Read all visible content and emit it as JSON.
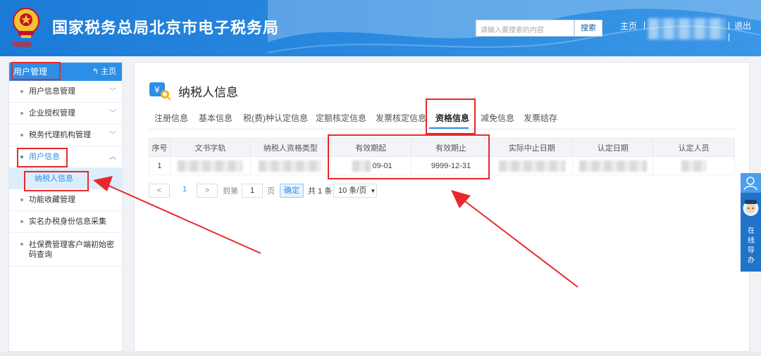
{
  "header": {
    "title": "国家税务总局北京市电子税务局",
    "emblem_caption": "中国税务",
    "search_placeholder": "请输入要搜索的内容",
    "search_button": "搜索",
    "home_link": "主页",
    "separator": "|",
    "logout": "退出"
  },
  "sidebar": {
    "header_title": "用户管理",
    "header_home": "主页",
    "items": [
      {
        "label": "用户信息管理"
      },
      {
        "label": "企业授权管理"
      },
      {
        "label": "税务代理机构管理"
      },
      {
        "label": "用户信息"
      },
      {
        "label": "纳税人信息"
      },
      {
        "label": "功能收藏管理"
      },
      {
        "label": "实名办税身份信息采集"
      },
      {
        "label": "社保费管理客户端初始密码查询"
      }
    ]
  },
  "main": {
    "title": "纳税人信息",
    "tabs": [
      "注册信息",
      "基本信息",
      "税(费)种认定信息",
      "定额核定信息",
      "发票核定信息",
      "资格信息",
      "减免信息",
      "发票结存"
    ],
    "active_tab": "资格信息",
    "table": {
      "headers": [
        "序号",
        "文书字轨",
        "纳税人资格类型",
        "有效期起",
        "有效期止",
        "实际中止日期",
        "认定日期",
        "认定人员"
      ],
      "rows": [
        {
          "index": "1",
          "valid_from": "09-01",
          "valid_to": "9999-12-31"
        }
      ]
    },
    "pager": {
      "prev": "<",
      "page": "1",
      "next": ">",
      "goto_label": "到第",
      "goto_value": "1",
      "page_suffix": "页",
      "confirm": "确定",
      "total": "共 1 条",
      "page_size": "10 条/页"
    }
  },
  "float_widget": {
    "label": "在线导办"
  },
  "colors": {
    "header_blue": "#2a8ae0",
    "accent": "#2c8ee6",
    "annotation_red": "#e8282b"
  }
}
